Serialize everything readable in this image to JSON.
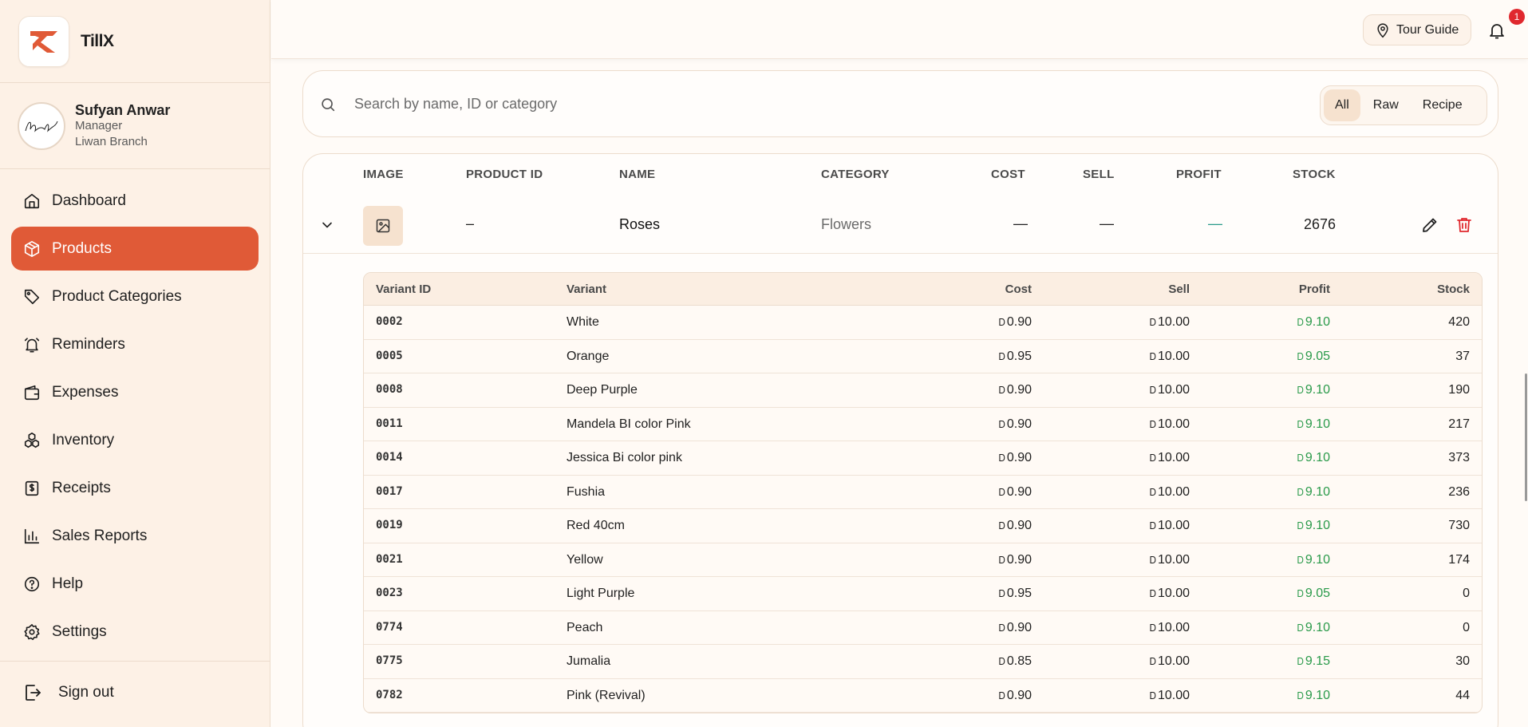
{
  "app": {
    "name": "TillX"
  },
  "user": {
    "name": "Sufyan Anwar",
    "role": "Manager",
    "branch": "Liwan Branch"
  },
  "nav": [
    {
      "label": "Dashboard",
      "icon": "home-icon",
      "active": false
    },
    {
      "label": "Products",
      "icon": "box-icon",
      "active": true
    },
    {
      "label": "Product Categories",
      "icon": "tag-icon",
      "active": false
    },
    {
      "label": "Reminders",
      "icon": "alarm-icon",
      "active": false
    },
    {
      "label": "Expenses",
      "icon": "wallet-icon",
      "active": false
    },
    {
      "label": "Inventory",
      "icon": "boxes-icon",
      "active": false
    },
    {
      "label": "Receipts",
      "icon": "receipt-icon",
      "active": false
    },
    {
      "label": "Sales Reports",
      "icon": "bar-chart-icon",
      "active": false
    },
    {
      "label": "Help",
      "icon": "help-icon",
      "active": false
    },
    {
      "label": "Settings",
      "icon": "gear-icon",
      "active": false
    }
  ],
  "signout": {
    "label": "Sign out"
  },
  "topbar": {
    "tour_label": "Tour Guide",
    "notification_count": "1"
  },
  "search": {
    "placeholder": "Search by name, ID or category",
    "value": ""
  },
  "filters": [
    {
      "label": "All",
      "active": true
    },
    {
      "label": "Raw",
      "active": false
    },
    {
      "label": "Recipe",
      "active": false
    }
  ],
  "table": {
    "headers": {
      "image": "IMAGE",
      "product_id": "PRODUCT ID",
      "name": "NAME",
      "category": "CATEGORY",
      "cost": "COST",
      "sell": "SELL",
      "profit": "PROFIT",
      "stock": "STOCK"
    },
    "product": {
      "product_id": "–",
      "name": "Roses",
      "category": "Flowers",
      "cost": "—",
      "sell": "—",
      "profit": "—",
      "stock": "2676"
    },
    "variant_headers": {
      "id": "Variant ID",
      "variant": "Variant",
      "cost": "Cost",
      "sell": "Sell",
      "profit": "Profit",
      "stock": "Stock"
    },
    "currency_symbol": "Ꭰ",
    "variants": [
      {
        "id": "0002",
        "variant": "White",
        "cost": "0.90",
        "sell": "10.00",
        "profit": "9.10",
        "stock": "420"
      },
      {
        "id": "0005",
        "variant": "Orange",
        "cost": "0.95",
        "sell": "10.00",
        "profit": "9.05",
        "stock": "37"
      },
      {
        "id": "0008",
        "variant": "Deep Purple",
        "cost": "0.90",
        "sell": "10.00",
        "profit": "9.10",
        "stock": "190"
      },
      {
        "id": "0011",
        "variant": "Mandela BI color Pink",
        "cost": "0.90",
        "sell": "10.00",
        "profit": "9.10",
        "stock": "217"
      },
      {
        "id": "0014",
        "variant": "Jessica Bi color pink",
        "cost": "0.90",
        "sell": "10.00",
        "profit": "9.10",
        "stock": "373"
      },
      {
        "id": "0017",
        "variant": "Fushia",
        "cost": "0.90",
        "sell": "10.00",
        "profit": "9.10",
        "stock": "236"
      },
      {
        "id": "0019",
        "variant": "Red 40cm",
        "cost": "0.90",
        "sell": "10.00",
        "profit": "9.10",
        "stock": "730"
      },
      {
        "id": "0021",
        "variant": "Yellow",
        "cost": "0.90",
        "sell": "10.00",
        "profit": "9.10",
        "stock": "174"
      },
      {
        "id": "0023",
        "variant": "Light Purple",
        "cost": "0.95",
        "sell": "10.00",
        "profit": "9.05",
        "stock": "0"
      },
      {
        "id": "0774",
        "variant": "Peach",
        "cost": "0.90",
        "sell": "10.00",
        "profit": "9.10",
        "stock": "0"
      },
      {
        "id": "0775",
        "variant": "Jumalia",
        "cost": "0.85",
        "sell": "10.00",
        "profit": "9.15",
        "stock": "30"
      },
      {
        "id": "0782",
        "variant": "Pink (Revival)",
        "cost": "0.90",
        "sell": "10.00",
        "profit": "9.10",
        "stock": "44"
      }
    ]
  },
  "colors": {
    "accent": "#e05a37",
    "sidebar_bg": "#fdf1e6",
    "profit_green": "#2a9a4a",
    "badge_red": "#e0282e"
  }
}
